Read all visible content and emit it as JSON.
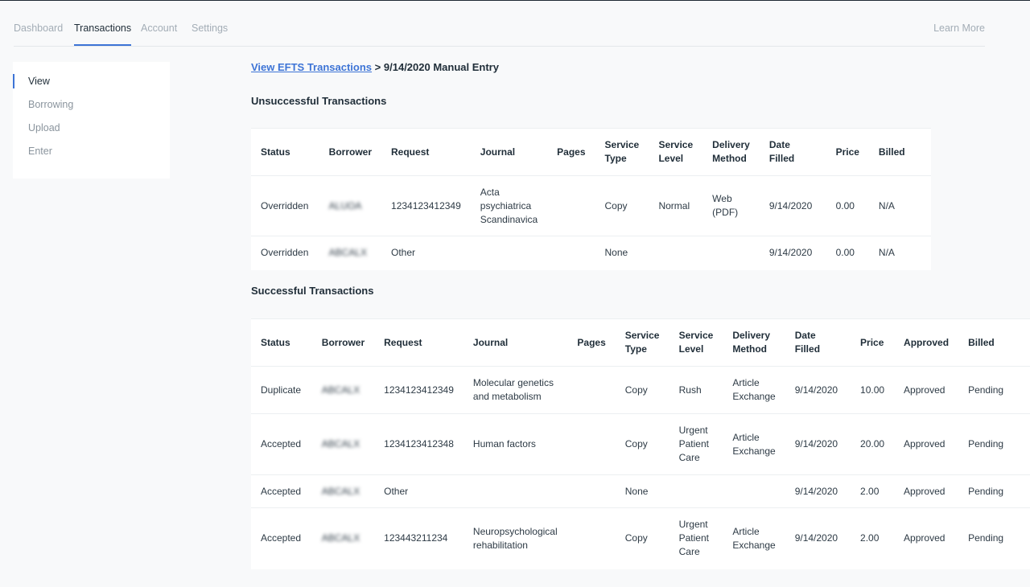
{
  "nav": {
    "tabs": [
      "Dashboard",
      "Transactions",
      "Account",
      "Settings"
    ],
    "learn_more": "Learn More"
  },
  "sidebar": {
    "items": [
      "View",
      "Borrowing",
      "Upload",
      "Enter"
    ]
  },
  "breadcrumb": {
    "link": "View EFTS Transactions",
    "separator": ">",
    "current": "9/14/2020 Manual Entry"
  },
  "unsuccessful": {
    "title": "Unsuccessful Transactions",
    "headers": [
      "Status",
      "Borrower",
      "Request",
      "Journal",
      "Pages",
      "Service Type",
      "Service Level",
      "Delivery Method",
      "Date Filled",
      "Price",
      "Billed"
    ],
    "rows": [
      [
        "Overridden",
        "ALUOA",
        "1234123412349",
        "Acta psychiatrica Scandinavica",
        "",
        "Copy",
        "Normal",
        "Web (PDF)",
        "9/14/2020",
        "0.00",
        "N/A"
      ],
      [
        "Overridden",
        "ABCALX",
        "Other",
        "",
        "",
        "None",
        "",
        "",
        "9/14/2020",
        "0.00",
        "N/A"
      ]
    ]
  },
  "successful": {
    "title": "Successful Transactions",
    "headers": [
      "Status",
      "Borrower",
      "Request",
      "Journal",
      "Pages",
      "Service Type",
      "Service Level",
      "Delivery Method",
      "Date Filled",
      "Price",
      "Approved",
      "Billed"
    ],
    "rows": [
      [
        "Duplicate",
        "ABCALX",
        "1234123412349",
        "Molecular genetics and metabolism",
        "",
        "Copy",
        "Rush",
        "Article Exchange",
        "9/14/2020",
        "10.00",
        "Approved",
        "Pending"
      ],
      [
        "Accepted",
        "ABCALX",
        "1234123412348",
        "Human factors",
        "",
        "Copy",
        "Urgent Patient Care",
        "Article Exchange",
        "9/14/2020",
        "20.00",
        "Approved",
        "Pending"
      ],
      [
        "Accepted",
        "ABCALX",
        "Other",
        "",
        "",
        "None",
        "",
        "",
        "9/14/2020",
        "2.00",
        "Approved",
        "Pending"
      ],
      [
        "Accepted",
        "ABCALX",
        "123443211234",
        "Neuropsychological rehabilitation",
        "",
        "Copy",
        "Urgent Patient Care",
        "Article Exchange",
        "9/14/2020",
        "2.00",
        "Approved",
        "Pending"
      ]
    ]
  },
  "colors": {
    "accent": "#3d74d6",
    "duplicate": "#f0962e",
    "accepted": "#3b9a47"
  }
}
